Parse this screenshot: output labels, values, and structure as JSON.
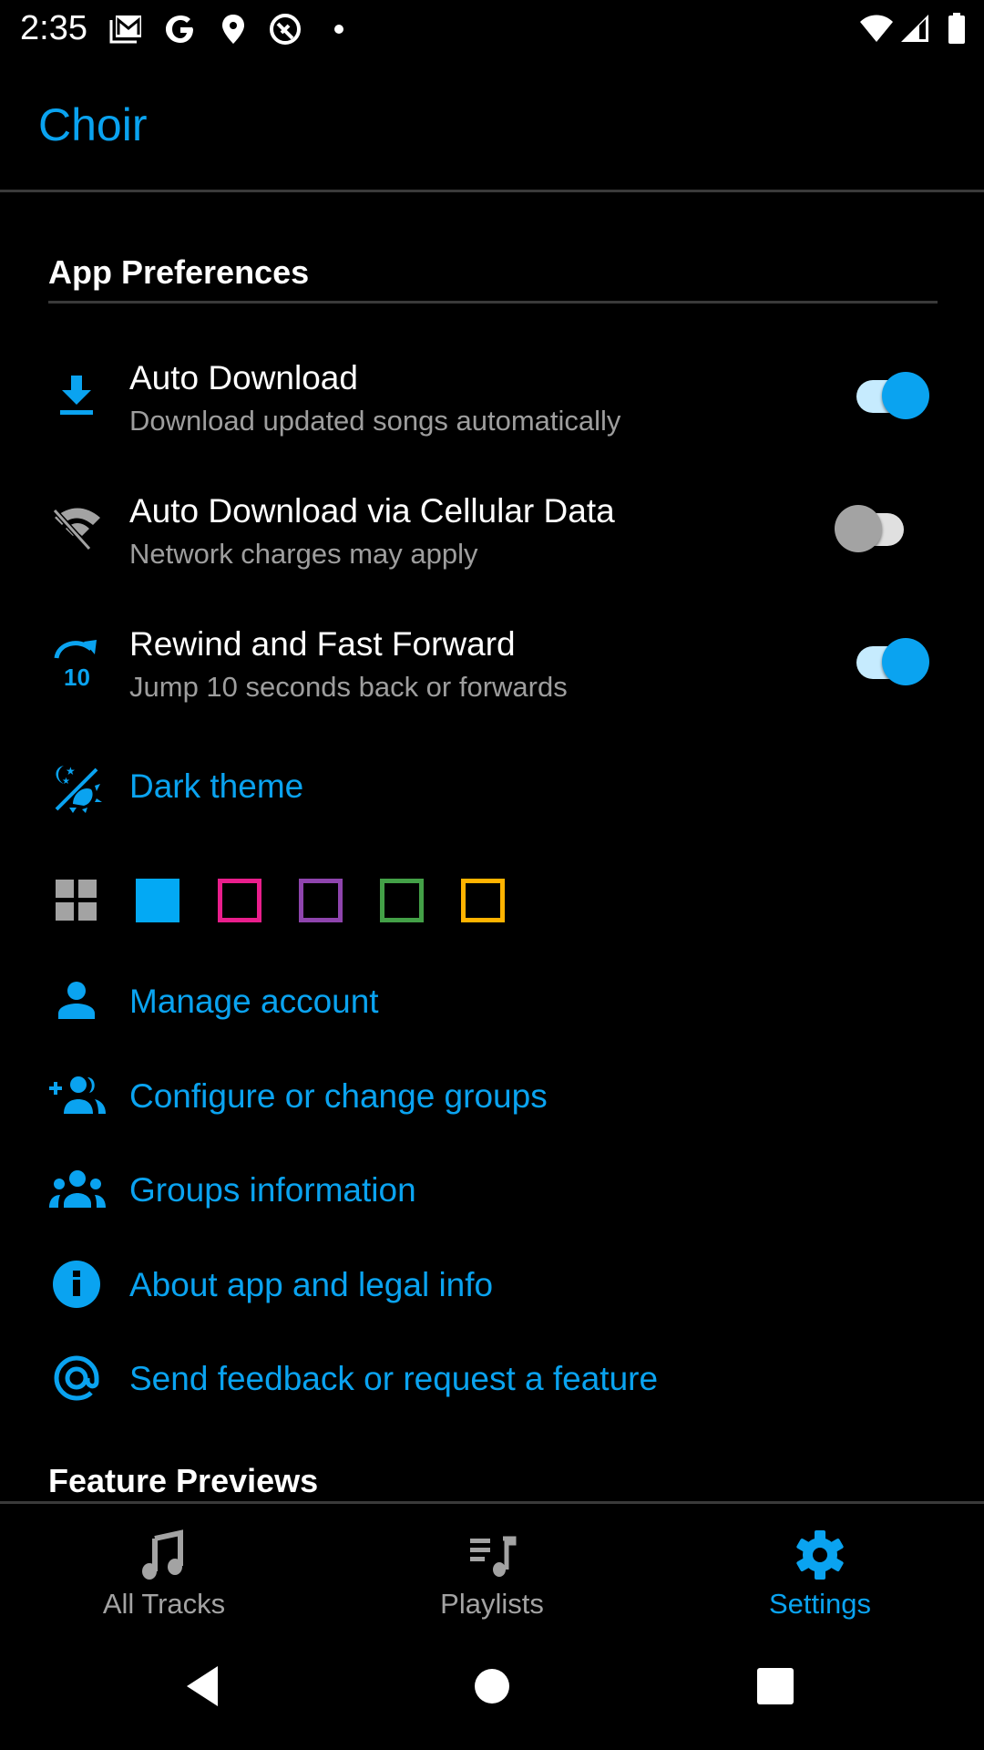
{
  "status_bar": {
    "time": "2:35",
    "left_icons": [
      "gmail-icon",
      "google-icon",
      "location-icon",
      "q-beta-icon",
      "notification-dot"
    ],
    "right_icons": [
      "wifi-icon",
      "cellular-signal-icon",
      "battery-icon"
    ]
  },
  "app_bar": {
    "title": "Choir"
  },
  "sections": {
    "app_preferences": {
      "header": "App Preferences"
    },
    "feature_previews": {
      "header": "Feature Previews"
    }
  },
  "toggles": [
    {
      "title": "Auto Download",
      "subtitle": "Download updated songs automatically",
      "icon": "download-icon",
      "enabled": true
    },
    {
      "title": "Auto Download via Cellular Data",
      "subtitle": "Network charges may apply",
      "icon": "signal-wifi-off-icon",
      "enabled": false
    },
    {
      "title": "Rewind and Fast Forward",
      "subtitle": "Jump 10 seconds back or forwards",
      "icon": "forward-10-icon",
      "enabled": true
    }
  ],
  "dark_theme": {
    "label": "Dark theme",
    "icon": "theme-light-dark-icon"
  },
  "color_theme": {
    "icon": "dashboard-icon",
    "swatches": [
      {
        "name": "blue",
        "color": "#03a9f4",
        "selected": true
      },
      {
        "name": "pink",
        "color": "#e91e8c",
        "selected": false
      },
      {
        "name": "purple",
        "color": "#8e44ad",
        "selected": false
      },
      {
        "name": "green",
        "color": "#43a047",
        "selected": false
      },
      {
        "name": "amber",
        "color": "#ffb300",
        "selected": false
      }
    ]
  },
  "links": [
    {
      "label": "Manage account",
      "icon": "person-icon"
    },
    {
      "label": "Configure or change groups",
      "icon": "group-add-icon"
    },
    {
      "label": "Groups information",
      "icon": "groups-icon"
    },
    {
      "label": "About app and legal info",
      "icon": "info-icon"
    },
    {
      "label": "Send feedback or request a feature",
      "icon": "at-sign-icon"
    }
  ],
  "bottom_nav": {
    "items": [
      {
        "label": "All Tracks",
        "icon": "music-note-icon",
        "active": false
      },
      {
        "label": "Playlists",
        "icon": "playlist-music-icon",
        "active": false
      },
      {
        "label": "Settings",
        "icon": "gear-icon",
        "active": true
      }
    ]
  },
  "colors": {
    "accent": "#0aa3f0",
    "text_primary": "#ffffff",
    "text_secondary": "#9e9e9e",
    "inactive_icon": "#a3a3a3",
    "background": "#000000"
  }
}
